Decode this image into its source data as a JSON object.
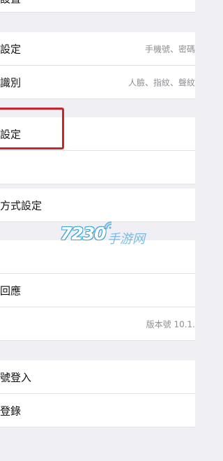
{
  "top_item": {
    "label": "設置"
  },
  "group1": {
    "rows": [
      {
        "label": "設定",
        "detail": "手機號、密碼"
      },
      {
        "label": "識別",
        "detail": "人臉、指紋、聲紋"
      }
    ]
  },
  "group2": {
    "rows": [
      {
        "label": "設定"
      },
      {
        "label": ""
      },
      {
        "label": "方式設定"
      }
    ]
  },
  "group3": {
    "rows": [
      {
        "label": ""
      },
      {
        "label": "回應"
      },
      {
        "label": "",
        "detail": "版本號 10.1."
      }
    ]
  },
  "group4": {
    "rows": [
      {
        "label": "號登入"
      },
      {
        "label": "登錄"
      }
    ]
  },
  "watermark": {
    "number": "7230",
    "name": "手游网"
  },
  "colors": {
    "background": "#efeff4",
    "highlight": "#c8262b",
    "watermark": "#3aa6d6"
  }
}
